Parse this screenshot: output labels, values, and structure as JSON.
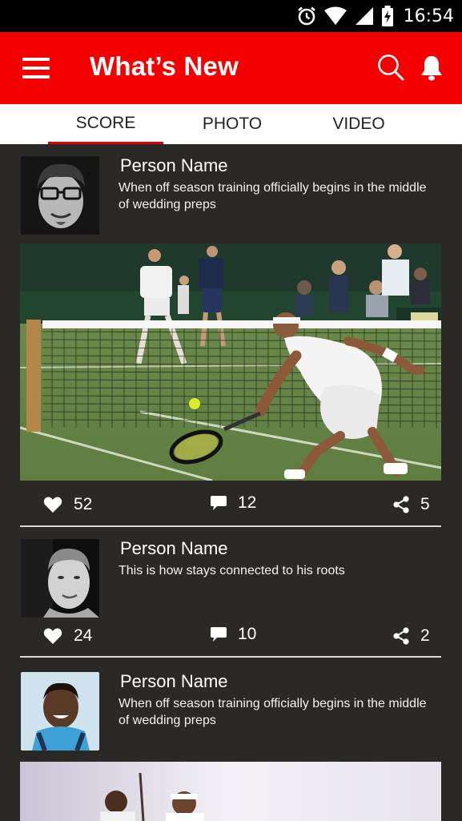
{
  "status_bar": {
    "time": "16:54"
  },
  "app_bar": {
    "title": "What’s New"
  },
  "tabs": [
    {
      "label": "SCORE",
      "active": true
    },
    {
      "label": "PHOTO",
      "active": false
    },
    {
      "label": "VIDEO",
      "active": false
    }
  ],
  "posts": [
    {
      "author": "Person Name",
      "caption": "When off season training officially begins in the middle of wedding preps",
      "has_image": true,
      "likes": "52",
      "comments": "12",
      "shares": "5"
    },
    {
      "author": "Person Name",
      "caption": "This is how stays connected to his roots",
      "has_image": false,
      "likes": "24",
      "comments": "10",
      "shares": "2"
    },
    {
      "author": "Person Name",
      "caption": "When off season training officially begins in the middle of wedding preps",
      "has_image": true
    }
  ],
  "icons": {
    "menu": "hamburger-menu-icon",
    "search": "search-icon",
    "notifications": "bell-icon",
    "like": "heart-icon",
    "comment": "comment-icon",
    "share": "share-icon"
  },
  "colors": {
    "accent": "#f40000",
    "feed_background": "#2b2926",
    "tab_indicator": "#e40000"
  }
}
